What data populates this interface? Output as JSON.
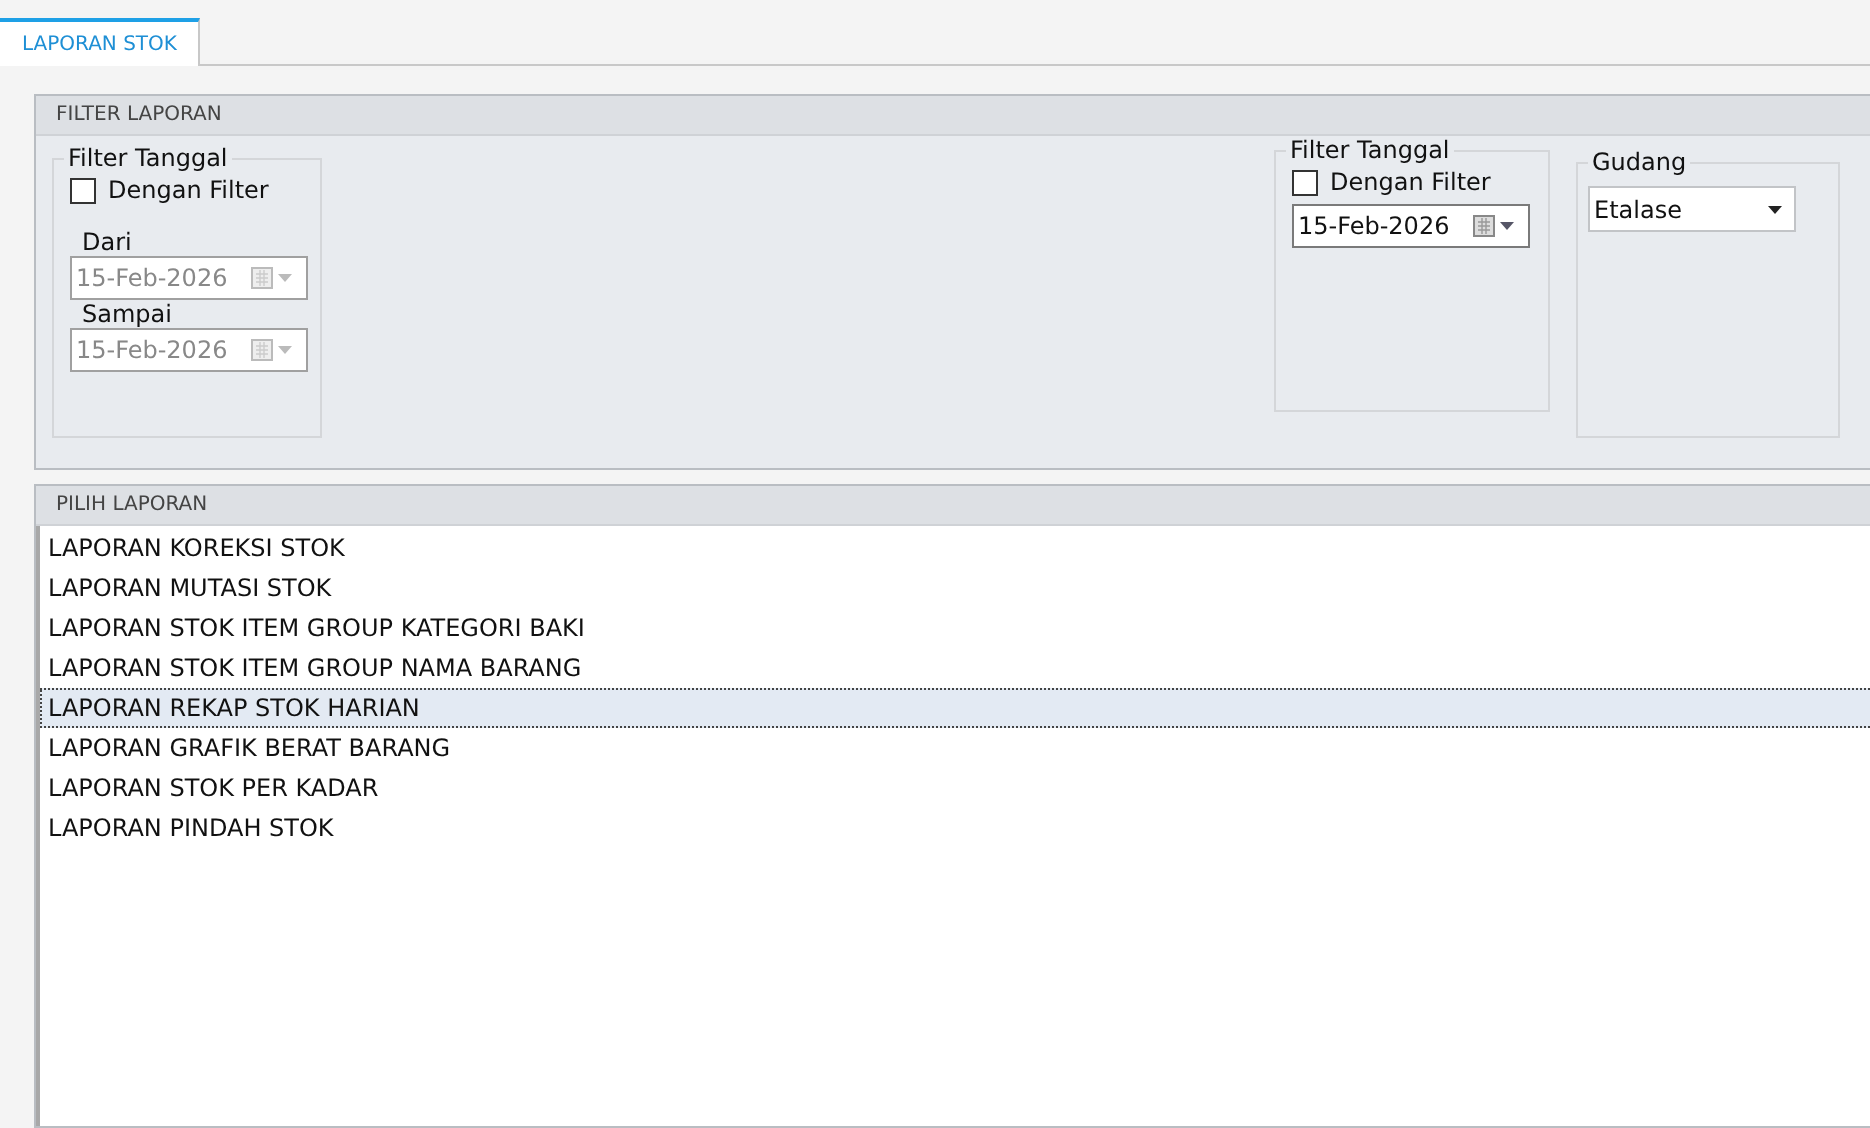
{
  "tabs": [
    {
      "label": "LAPORAN STOK",
      "selected": true
    }
  ],
  "filter_panel": {
    "title": "FILTER LAPORAN",
    "groups": [
      {
        "kind": "range",
        "title": "Filter Tanggal",
        "checkbox": {
          "label": "Dengan Filter",
          "checked": false
        },
        "fields": [
          {
            "label": "Dari",
            "value": "15-Feb-2026",
            "disabled": true
          },
          {
            "label": "Sampai",
            "value": "15-Feb-2026",
            "disabled": true
          }
        ]
      },
      {
        "kind": "single",
        "title": "Filter Tanggal",
        "checkbox": {
          "label": "Dengan Filter",
          "checked": false
        },
        "fields": [
          {
            "value": "15-Feb-2026",
            "disabled": false
          }
        ]
      },
      {
        "kind": "dropdown",
        "title": "Gudang",
        "value": "Etalase"
      }
    ]
  },
  "report_panel": {
    "title": "PILIH LAPORAN",
    "items": [
      {
        "label": "LAPORAN KOREKSI STOK",
        "selected": false
      },
      {
        "label": "LAPORAN MUTASI STOK",
        "selected": false
      },
      {
        "label": "LAPORAN STOK ITEM GROUP KATEGORI BAKI",
        "selected": false
      },
      {
        "label": "LAPORAN STOK ITEM GROUP NAMA BARANG",
        "selected": false
      },
      {
        "label": "LAPORAN REKAP STOK HARIAN",
        "selected": true
      },
      {
        "label": "LAPORAN GRAFIK BERAT BARANG",
        "selected": false
      },
      {
        "label": "LAPORAN STOK PER KADAR",
        "selected": false
      },
      {
        "label": "LAPORAN PINDAH STOK",
        "selected": false
      }
    ]
  }
}
